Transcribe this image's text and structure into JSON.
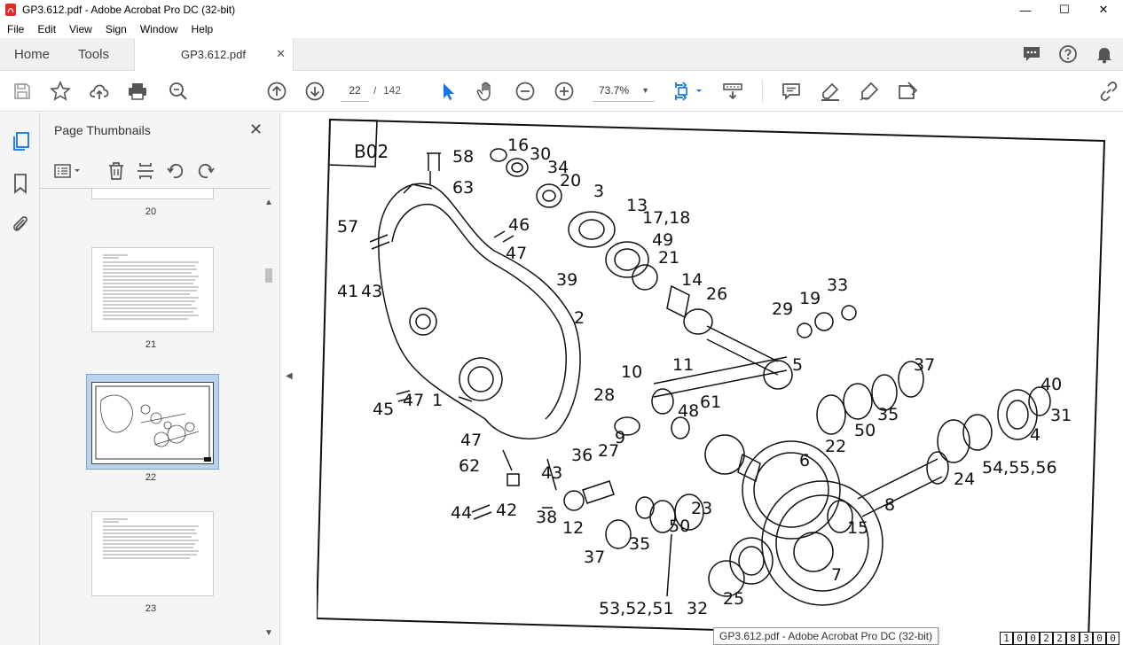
{
  "window": {
    "title": "GP3.612.pdf - Adobe Acrobat Pro DC (32-bit)"
  },
  "menu": [
    "File",
    "Edit",
    "View",
    "Sign",
    "Window",
    "Help"
  ],
  "tabs": {
    "home": "Home",
    "tools": "Tools",
    "document": "GP3.612.pdf",
    "close": "✕"
  },
  "toolbar": {
    "current_page": "22",
    "page_separator": "/",
    "page_total": "142",
    "zoom": "73.7%"
  },
  "panel": {
    "title": "Page Thumbnails",
    "thumbnails": [
      {
        "label": "20"
      },
      {
        "label": "21"
      },
      {
        "label": "22",
        "selected": true
      },
      {
        "label": "23"
      }
    ]
  },
  "drawing": {
    "label": "B02",
    "callouts": [
      "58",
      "63",
      "16",
      "30",
      "34",
      "20",
      "3",
      "13",
      "17,18",
      "49",
      "21",
      "57",
      "46",
      "47",
      "39",
      "41",
      "43",
      "14",
      "26",
      "2",
      "29",
      "19",
      "33",
      "11",
      "5",
      "37",
      "10",
      "40",
      "31",
      "45",
      "47",
      "1",
      "28",
      "48",
      "61",
      "35",
      "50",
      "22",
      "4",
      "9",
      "47",
      "62",
      "43",
      "36",
      "27",
      "6",
      "54,55,56",
      "24",
      "44",
      "42",
      "38",
      "12",
      "50",
      "23",
      "8",
      "15",
      "37",
      "35",
      "7",
      "53,52,51",
      "32",
      "25"
    ],
    "doc_number": [
      "1",
      "0",
      "0",
      "2",
      "2",
      "8",
      "3",
      "0",
      "0"
    ]
  },
  "tooltip": "GP3.612.pdf - Adobe Acrobat Pro DC (32-bit)",
  "colors": {
    "accent": "#1473e6",
    "pdf_red": "#e12a26",
    "selection": "#b9d3ee"
  },
  "icons": [
    "pdf-app-icon",
    "minimize-icon",
    "maximize-icon",
    "close-icon",
    "comments-icon",
    "help-icon",
    "bell-icon",
    "save-icon",
    "star-icon",
    "upload-icon",
    "print-icon",
    "search-zoom-icon",
    "arrow-up-icon",
    "arrow-down-icon",
    "select-cursor-icon",
    "hand-icon",
    "zoom-out-icon",
    "zoom-in-icon",
    "fit-page-icon",
    "scroll-mode-icon",
    "comment-icon",
    "highlight-icon",
    "sign-icon",
    "fill-sign-icon",
    "share-link-icon",
    "pages-icon",
    "bookmark-icon",
    "attachment-icon",
    "options-icon",
    "delete-icon",
    "crop-icon",
    "rotate-left-icon",
    "rotate-right-icon"
  ]
}
